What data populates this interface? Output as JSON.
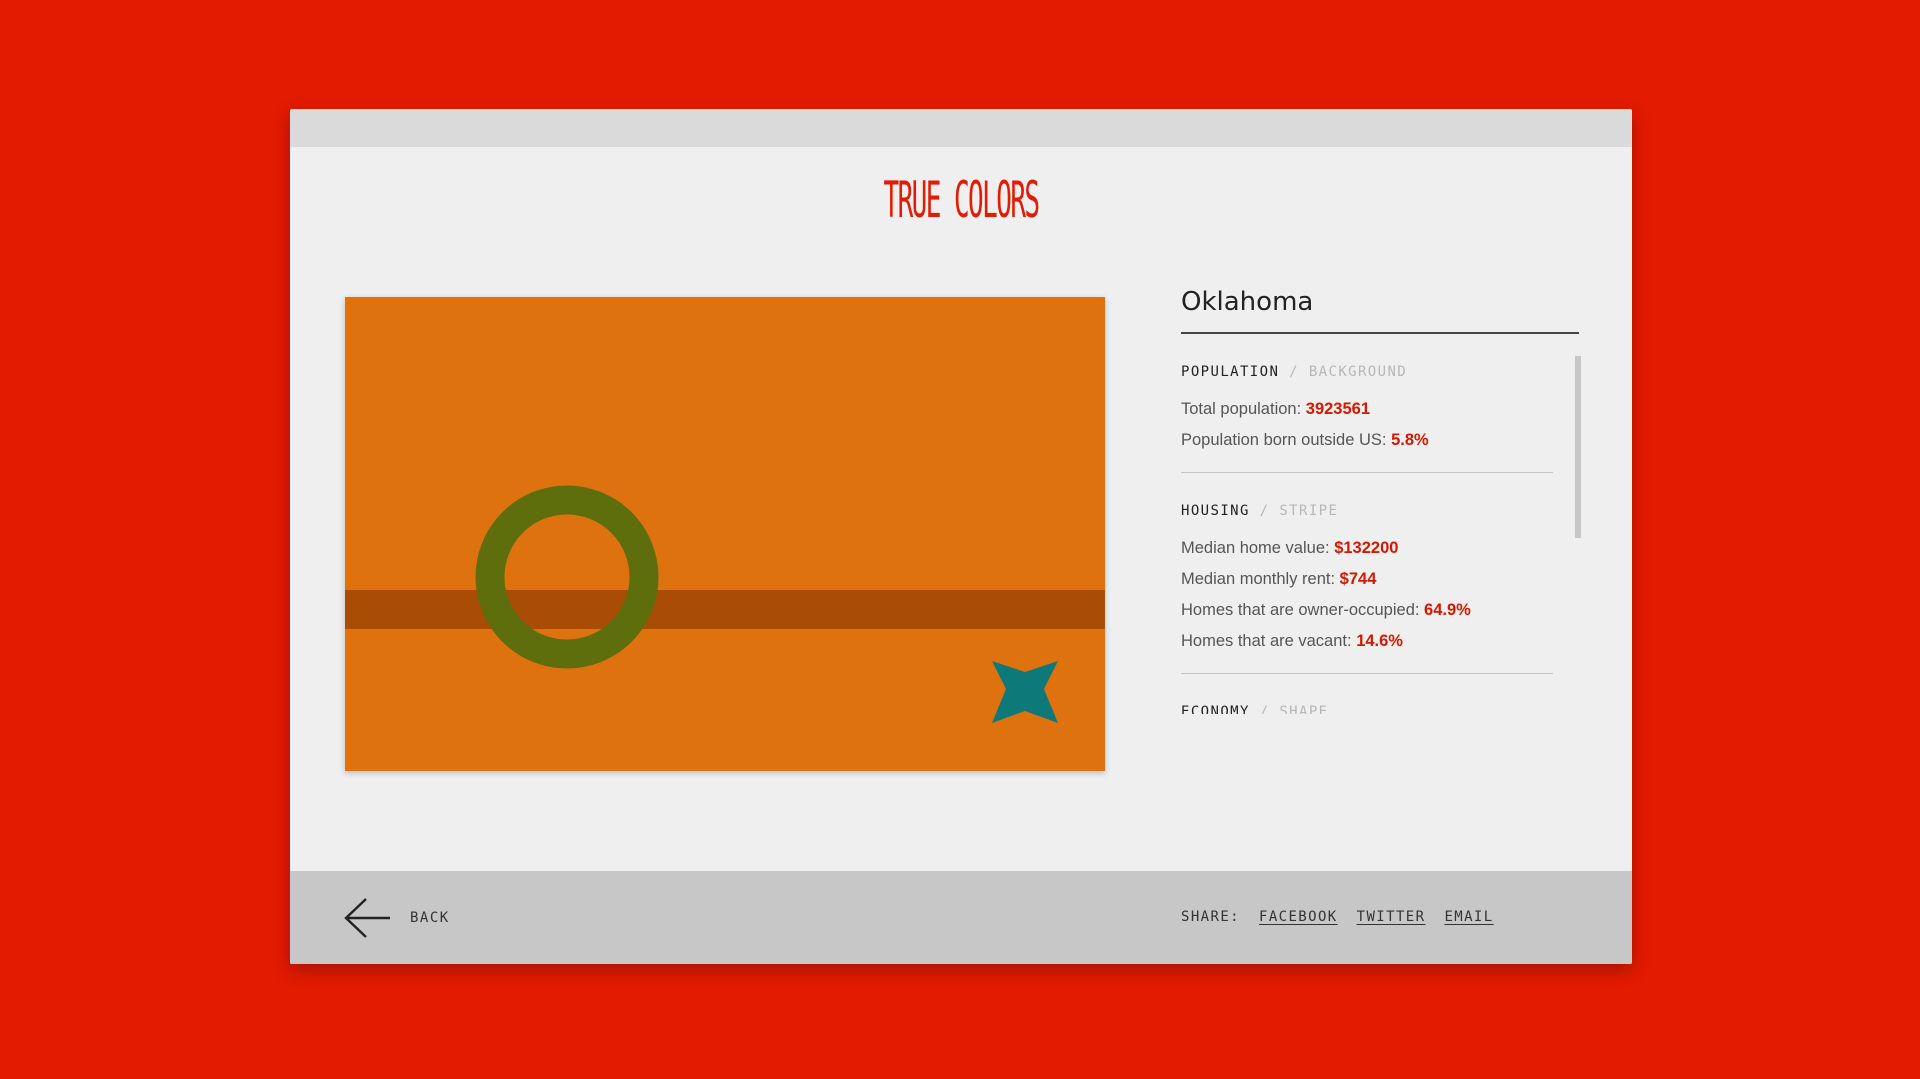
{
  "app": {
    "title": "TRUE COLORS"
  },
  "flag": {
    "background_color": "#de720f",
    "stripe_color": "#a94c06",
    "ring_color": "#5e6e0d",
    "star_color": "#0d7a79",
    "icons": [
      "ring-shape",
      "four-point-star-shape"
    ]
  },
  "state": {
    "name": "Oklahoma"
  },
  "sections": [
    {
      "title": "POPULATION",
      "subtitle": "BACKGROUND",
      "stats": [
        {
          "label": "Total population:",
          "value": "3923561"
        },
        {
          "label": "Population born outside US:",
          "value": "5.8%"
        }
      ]
    },
    {
      "title": "HOUSING",
      "subtitle": "STRIPE",
      "stats": [
        {
          "label": "Median home value:",
          "value": "$132200"
        },
        {
          "label": "Median monthly rent:",
          "value": "$744"
        },
        {
          "label": "Homes that are owner-occupied:",
          "value": "64.9%"
        },
        {
          "label": "Homes that are vacant:",
          "value": "14.6%"
        }
      ]
    },
    {
      "title": "ECONOMY",
      "subtitle": "SHAPE",
      "stats": []
    }
  ],
  "separator": "/",
  "footer": {
    "back_label": "BACK",
    "share_label": "SHARE:",
    "share_links": [
      "FACEBOOK",
      "TWITTER",
      "EMAIL"
    ]
  },
  "colors": {
    "page_background": "#e31b00",
    "accent": "#e31b00",
    "value_red": "#d21a00"
  }
}
